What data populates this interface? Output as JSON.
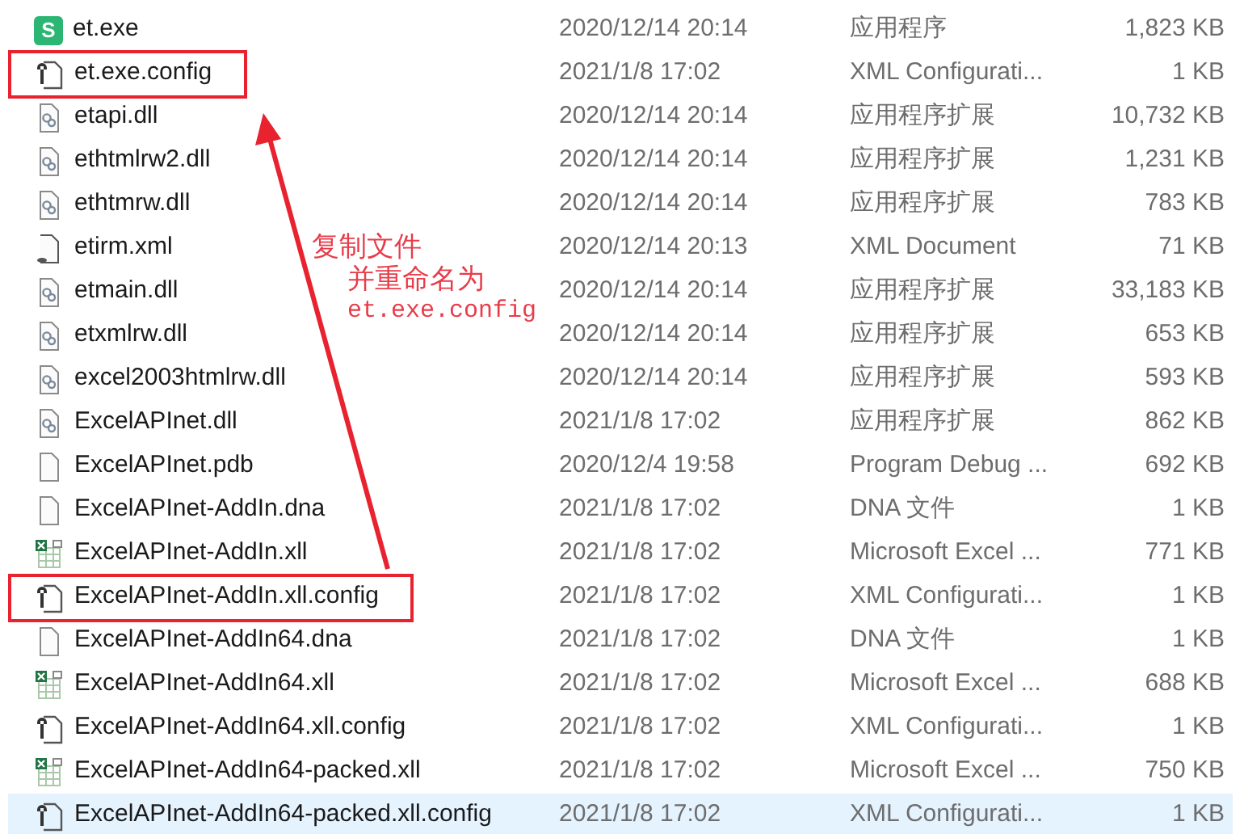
{
  "files": [
    {
      "kind": "exe",
      "icon_text": "S",
      "name": "et.exe",
      "modified": "2020/12/14 20:14",
      "type": "应用程序",
      "size": "1,823 KB",
      "boxed": false,
      "selected": false
    },
    {
      "kind": "config",
      "name": "et.exe.config",
      "modified": "2021/1/8 17:02",
      "type": "XML Configurati...",
      "size": "1 KB",
      "boxed": true,
      "selected": false
    },
    {
      "kind": "dll",
      "name": "etapi.dll",
      "modified": "2020/12/14 20:14",
      "type": "应用程序扩展",
      "size": "10,732 KB",
      "boxed": false,
      "selected": false
    },
    {
      "kind": "dll",
      "name": "ethtmlrw2.dll",
      "modified": "2020/12/14 20:14",
      "type": "应用程序扩展",
      "size": "1,231 KB",
      "boxed": false,
      "selected": false
    },
    {
      "kind": "dll",
      "name": "ethtmrw.dll",
      "modified": "2020/12/14 20:14",
      "type": "应用程序扩展",
      "size": "783 KB",
      "boxed": false,
      "selected": false
    },
    {
      "kind": "xml",
      "name": "etirm.xml",
      "modified": "2020/12/14 20:13",
      "type": "XML Document",
      "size": "71 KB",
      "boxed": false,
      "selected": false
    },
    {
      "kind": "dll",
      "name": "etmain.dll",
      "modified": "2020/12/14 20:14",
      "type": "应用程序扩展",
      "size": "33,183 KB",
      "boxed": false,
      "selected": false
    },
    {
      "kind": "dll",
      "name": "etxmlrw.dll",
      "modified": "2020/12/14 20:14",
      "type": "应用程序扩展",
      "size": "653 KB",
      "boxed": false,
      "selected": false
    },
    {
      "kind": "dll",
      "name": "excel2003htmlrw.dll",
      "modified": "2020/12/14 20:14",
      "type": "应用程序扩展",
      "size": "593 KB",
      "boxed": false,
      "selected": false
    },
    {
      "kind": "dll",
      "name": "ExcelAPInet.dll",
      "modified": "2021/1/8 17:02",
      "type": "应用程序扩展",
      "size": "862 KB",
      "boxed": false,
      "selected": false
    },
    {
      "kind": "blank",
      "name": "ExcelAPInet.pdb",
      "modified": "2020/12/4 19:58",
      "type": "Program Debug ...",
      "size": "692 KB",
      "boxed": false,
      "selected": false
    },
    {
      "kind": "blank",
      "name": "ExcelAPInet-AddIn.dna",
      "modified": "2021/1/8 17:02",
      "type": "DNA 文件",
      "size": "1 KB",
      "boxed": false,
      "selected": false
    },
    {
      "kind": "xll",
      "name": "ExcelAPInet-AddIn.xll",
      "modified": "2021/1/8 17:02",
      "type": "Microsoft Excel ...",
      "size": "771 KB",
      "boxed": false,
      "selected": false
    },
    {
      "kind": "config",
      "name": "ExcelAPInet-AddIn.xll.config",
      "modified": "2021/1/8 17:02",
      "type": "XML Configurati...",
      "size": "1 KB",
      "boxed": true,
      "selected": false
    },
    {
      "kind": "blank",
      "name": "ExcelAPInet-AddIn64.dna",
      "modified": "2021/1/8 17:02",
      "type": "DNA 文件",
      "size": "1 KB",
      "boxed": false,
      "selected": false
    },
    {
      "kind": "xll",
      "name": "ExcelAPInet-AddIn64.xll",
      "modified": "2021/1/8 17:02",
      "type": "Microsoft Excel ...",
      "size": "688 KB",
      "boxed": false,
      "selected": false
    },
    {
      "kind": "config",
      "name": "ExcelAPInet-AddIn64.xll.config",
      "modified": "2021/1/8 17:02",
      "type": "XML Configurati...",
      "size": "1 KB",
      "boxed": false,
      "selected": false
    },
    {
      "kind": "xll",
      "name": "ExcelAPInet-AddIn64-packed.xll",
      "modified": "2021/1/8 17:02",
      "type": "Microsoft Excel ...",
      "size": "750 KB",
      "boxed": false,
      "selected": false
    },
    {
      "kind": "config",
      "name": "ExcelAPInet-AddIn64-packed.xll.config",
      "modified": "2021/1/8 17:02",
      "type": "XML Configurati...",
      "size": "1 KB",
      "boxed": false,
      "selected": true
    }
  ],
  "annotation": {
    "lines": [
      "复制文件",
      "并重命名为"
    ],
    "code": "et.exe.config"
  }
}
